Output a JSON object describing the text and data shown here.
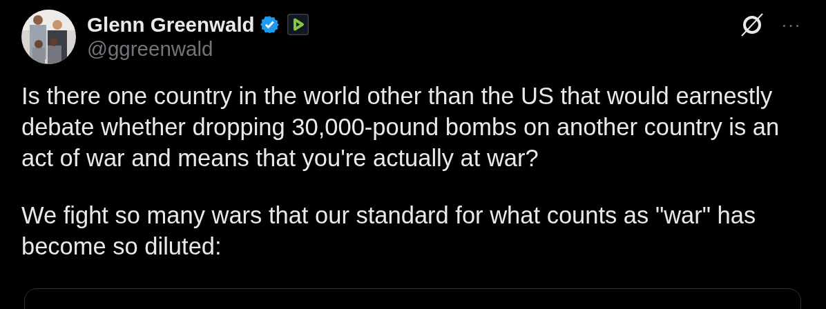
{
  "author": {
    "name": "Glenn Greenwald",
    "handle": "@ggreenwald",
    "verified": true
  },
  "tweet": {
    "paragraphs": [
      "Is there one country in the world other than the US that would earnestly debate whether dropping 30,000-pound bombs on another country is an act of war and means that you're actually at war?",
      "We fight so many wars that our standard for what counts as \"war\" has become so diluted:"
    ]
  },
  "more_button": "···"
}
